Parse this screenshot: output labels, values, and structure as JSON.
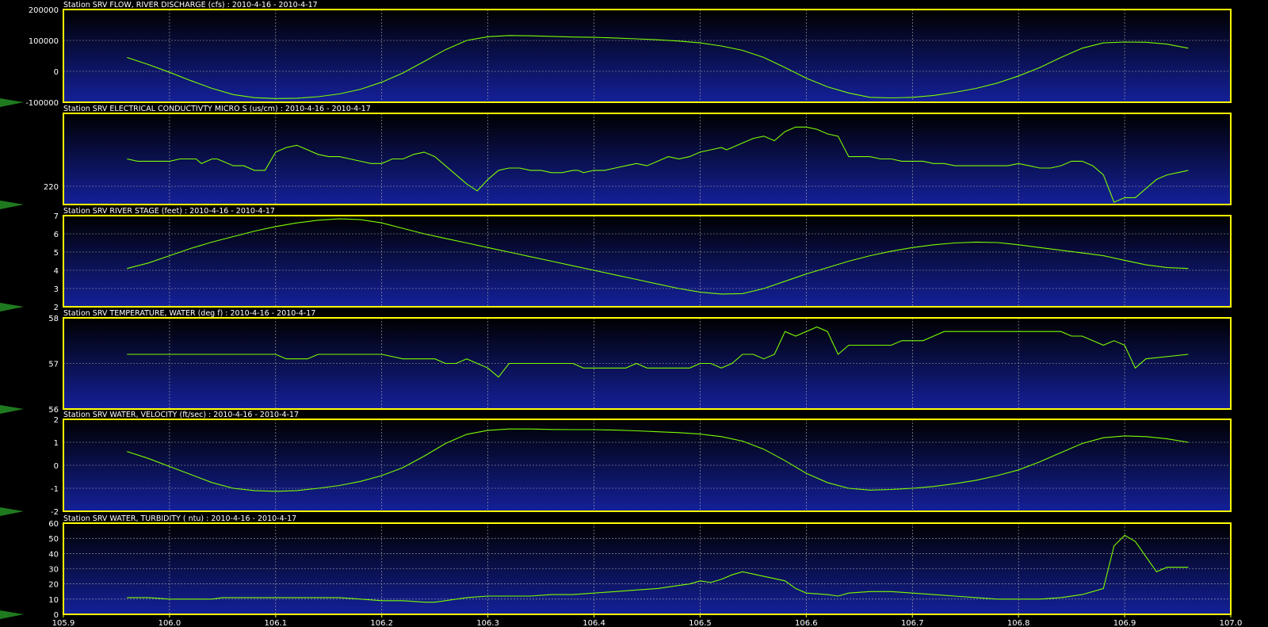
{
  "colors": {
    "background": "#000000",
    "frame": "#ffff00",
    "series": "#7cfc00",
    "panel_top": "#000000",
    "panel_bottom": "#14209a",
    "grid": "#b0b0b0",
    "marker": "#1f7a1f"
  },
  "chart_data": [
    {
      "type": "line",
      "title": "Station SRV FLOW, RIVER DISCHARGE (cfs) : 2010-4-16 - 2010-4-17",
      "ylim": [
        -100000,
        200000
      ],
      "yticks": [
        -100000,
        0,
        100000,
        200000
      ],
      "ytick_labels": [
        "-100000",
        "0",
        "100000",
        "200000"
      ],
      "x": [
        105.96,
        105.98,
        106.0,
        106.02,
        106.04,
        106.06,
        106.08,
        106.1,
        106.12,
        106.14,
        106.16,
        106.18,
        106.2,
        106.22,
        106.24,
        106.26,
        106.28,
        106.3,
        106.32,
        106.34,
        106.36,
        106.38,
        106.4,
        106.42,
        106.44,
        106.46,
        106.48,
        106.5,
        106.52,
        106.54,
        106.56,
        106.58,
        106.6,
        106.62,
        106.64,
        106.66,
        106.68,
        106.7,
        106.72,
        106.74,
        106.76,
        106.78,
        106.8,
        106.82,
        106.84,
        106.86,
        106.88,
        106.9,
        106.92,
        106.94,
        106.96
      ],
      "values": [
        45000,
        22000,
        -3000,
        -30000,
        -55000,
        -75000,
        -85000,
        -88000,
        -87000,
        -82000,
        -73000,
        -58000,
        -35000,
        -5000,
        32000,
        70000,
        100000,
        112000,
        116000,
        115000,
        113000,
        111000,
        110000,
        108000,
        105000,
        102000,
        98000,
        92000,
        82000,
        68000,
        45000,
        12000,
        -22000,
        -50000,
        -70000,
        -84000,
        -86000,
        -84000,
        -78000,
        -68000,
        -55000,
        -38000,
        -15000,
        12000,
        45000,
        75000,
        92000,
        95000,
        94000,
        88000,
        75000
      ]
    },
    {
      "type": "line",
      "title": "Station SRV ELECTRICAL CONDUCTIVTY MICRO S (us/cm) : 2010-4-16 - 2010-4-17",
      "ylim": [
        212,
        252
      ],
      "yticks": [
        220
      ],
      "ytick_labels": [
        "220"
      ],
      "x": [
        105.96,
        105.97,
        105.98,
        105.99,
        106.0,
        106.01,
        106.02,
        106.025,
        106.03,
        106.04,
        106.045,
        106.05,
        106.06,
        106.07,
        106.08,
        106.09,
        106.1,
        106.11,
        106.12,
        106.13,
        106.14,
        106.15,
        106.16,
        106.17,
        106.18,
        106.19,
        106.2,
        106.21,
        106.22,
        106.23,
        106.24,
        106.25,
        106.26,
        106.27,
        106.28,
        106.29,
        106.3,
        106.31,
        106.32,
        106.33,
        106.34,
        106.35,
        106.36,
        106.37,
        106.38,
        106.385,
        106.39,
        106.4,
        106.41,
        106.42,
        106.43,
        106.44,
        106.45,
        106.46,
        106.47,
        106.48,
        106.49,
        106.5,
        106.51,
        106.52,
        106.525,
        106.53,
        106.54,
        106.55,
        106.56,
        106.57,
        106.58,
        106.59,
        106.6,
        106.61,
        106.62,
        106.63,
        106.64,
        106.65,
        106.66,
        106.67,
        106.68,
        106.69,
        106.7,
        106.71,
        106.72,
        106.73,
        106.74,
        106.75,
        106.76,
        106.77,
        106.78,
        106.79,
        106.8,
        106.81,
        106.82,
        106.83,
        106.84,
        106.85,
        106.86,
        106.87,
        106.88,
        106.89,
        106.9,
        106.91,
        106.92,
        106.93,
        106.94,
        106.95,
        106.96
      ],
      "values": [
        232,
        231,
        231,
        231,
        231,
        232,
        232,
        232,
        230,
        232,
        232,
        231,
        229,
        229,
        227,
        227,
        235,
        237,
        238,
        236,
        234,
        233,
        233,
        232,
        231,
        230,
        230,
        232,
        232,
        234,
        235,
        233,
        229,
        225,
        221,
        218,
        223,
        227,
        228,
        228,
        227,
        227,
        226,
        226,
        227,
        227,
        226,
        227,
        227,
        228,
        229,
        230,
        229,
        231,
        233,
        232,
        233,
        235,
        236,
        237,
        236,
        237,
        239,
        241,
        242,
        240,
        244,
        246,
        246,
        245,
        243,
        242,
        233,
        233,
        233,
        232,
        232,
        231,
        231,
        231,
        230,
        230,
        229,
        229,
        229,
        229,
        229,
        229,
        230,
        229,
        228,
        228,
        229,
        231,
        231,
        229,
        225,
        213,
        215,
        215,
        219,
        223,
        225,
        226,
        227
      ]
    },
    {
      "type": "line",
      "title": "Station SRV RIVER STAGE (feet) : 2010-4-16 - 2010-4-17",
      "ylim": [
        2,
        7
      ],
      "yticks": [
        2,
        3,
        4,
        5,
        6,
        7
      ],
      "ytick_labels": [
        "2",
        "3",
        "4",
        "5",
        "6",
        "7"
      ],
      "x": [
        105.96,
        105.98,
        106.0,
        106.02,
        106.04,
        106.06,
        106.08,
        106.1,
        106.12,
        106.14,
        106.16,
        106.18,
        106.2,
        106.22,
        106.24,
        106.26,
        106.28,
        106.3,
        106.32,
        106.34,
        106.36,
        106.38,
        106.4,
        106.42,
        106.44,
        106.46,
        106.48,
        106.5,
        106.52,
        106.54,
        106.56,
        106.58,
        106.6,
        106.62,
        106.64,
        106.66,
        106.68,
        106.7,
        106.72,
        106.74,
        106.76,
        106.78,
        106.8,
        106.82,
        106.84,
        106.86,
        106.88,
        106.9,
        106.92,
        106.94,
        106.96
      ],
      "values": [
        4.1,
        4.4,
        4.8,
        5.2,
        5.55,
        5.85,
        6.15,
        6.4,
        6.6,
        6.75,
        6.82,
        6.78,
        6.6,
        6.3,
        6.0,
        5.75,
        5.5,
        5.25,
        5.0,
        4.75,
        4.5,
        4.25,
        4.0,
        3.75,
        3.5,
        3.25,
        3.0,
        2.8,
        2.7,
        2.72,
        3.0,
        3.4,
        3.8,
        4.15,
        4.5,
        4.8,
        5.05,
        5.25,
        5.4,
        5.5,
        5.55,
        5.52,
        5.4,
        5.25,
        5.1,
        4.95,
        4.8,
        4.55,
        4.3,
        4.15,
        4.1
      ]
    },
    {
      "type": "line",
      "title": "Station SRV TEMPERATURE, WATER (deg f) : 2010-4-16 - 2010-4-17",
      "ylim": [
        56,
        58
      ],
      "yticks": [
        56,
        57,
        58
      ],
      "ytick_labels": [
        "56",
        "57",
        "58"
      ],
      "x": [
        105.96,
        106.1,
        106.11,
        106.13,
        106.14,
        106.2,
        106.22,
        106.24,
        106.25,
        106.26,
        106.27,
        106.28,
        106.29,
        106.3,
        106.31,
        106.32,
        106.33,
        106.34,
        106.38,
        106.39,
        106.42,
        106.43,
        106.44,
        106.45,
        106.49,
        106.5,
        106.51,
        106.52,
        106.53,
        106.54,
        106.55,
        106.56,
        106.57,
        106.58,
        106.59,
        106.6,
        106.61,
        106.62,
        106.63,
        106.64,
        106.65,
        106.66,
        106.67,
        106.68,
        106.69,
        106.7,
        106.71,
        106.72,
        106.73,
        106.74,
        106.84,
        106.85,
        106.86,
        106.87,
        106.88,
        106.89,
        106.9,
        106.91,
        106.92,
        106.96
      ],
      "values": [
        57.2,
        57.2,
        57.1,
        57.1,
        57.2,
        57.2,
        57.1,
        57.1,
        57.1,
        57.0,
        57.0,
        57.1,
        57.0,
        56.9,
        56.7,
        57.0,
        57.0,
        57.0,
        57.0,
        56.9,
        56.9,
        56.9,
        57.0,
        56.9,
        56.9,
        57.0,
        57.0,
        56.9,
        57.0,
        57.2,
        57.2,
        57.1,
        57.2,
        57.7,
        57.6,
        57.7,
        57.8,
        57.7,
        57.2,
        57.4,
        57.4,
        57.4,
        57.4,
        57.4,
        57.5,
        57.5,
        57.5,
        57.6,
        57.7,
        57.7,
        57.7,
        57.6,
        57.6,
        57.5,
        57.4,
        57.5,
        57.4,
        56.9,
        57.1,
        57.2
      ]
    },
    {
      "type": "line",
      "title": "Station SRV WATER, VELOCITY (ft/sec) : 2010-4-16 - 2010-4-17",
      "ylim": [
        -2,
        2
      ],
      "yticks": [
        -2,
        -1,
        0,
        1,
        2
      ],
      "ytick_labels": [
        "-2",
        "-1",
        "0",
        "1",
        "2"
      ],
      "x": [
        105.96,
        105.98,
        106.0,
        106.02,
        106.04,
        106.06,
        106.08,
        106.1,
        106.12,
        106.14,
        106.16,
        106.18,
        106.2,
        106.22,
        106.24,
        106.26,
        106.28,
        106.3,
        106.32,
        106.34,
        106.36,
        106.38,
        106.4,
        106.42,
        106.44,
        106.46,
        106.48,
        106.5,
        106.52,
        106.54,
        106.56,
        106.58,
        106.6,
        106.62,
        106.64,
        106.66,
        106.68,
        106.7,
        106.72,
        106.74,
        106.76,
        106.78,
        106.8,
        106.82,
        106.84,
        106.86,
        106.88,
        106.9,
        106.92,
        106.94,
        106.96
      ],
      "values": [
        0.6,
        0.3,
        -0.05,
        -0.4,
        -0.75,
        -1.0,
        -1.1,
        -1.13,
        -1.1,
        -1.0,
        -0.88,
        -0.7,
        -0.45,
        -0.1,
        0.4,
        0.95,
        1.35,
        1.52,
        1.58,
        1.58,
        1.56,
        1.55,
        1.55,
        1.53,
        1.5,
        1.46,
        1.42,
        1.36,
        1.25,
        1.05,
        0.7,
        0.2,
        -0.35,
        -0.75,
        -1.0,
        -1.08,
        -1.05,
        -1.0,
        -0.92,
        -0.8,
        -0.65,
        -0.45,
        -0.2,
        0.15,
        0.55,
        0.95,
        1.2,
        1.28,
        1.25,
        1.15,
        1.0
      ]
    },
    {
      "type": "line",
      "title": "Station SRV WATER, TURBIDITY (  ntu) : 2010-4-16 - 2010-4-17",
      "ylim": [
        0,
        60
      ],
      "yticks": [
        0,
        10,
        20,
        30,
        40,
        50,
        60
      ],
      "ytick_labels": [
        "0",
        "10",
        "20",
        "30",
        "40",
        "50",
        "60"
      ],
      "xticks": [
        105.9,
        106.0,
        106.1,
        106.2,
        106.3,
        106.4,
        106.5,
        106.6,
        106.7,
        106.8,
        106.9,
        107.0
      ],
      "xtick_labels": [
        "105.9",
        "106.0",
        "106.1",
        "106.2",
        "106.3",
        "106.4",
        "106.5",
        "106.6",
        "106.7",
        "106.8",
        "106.9",
        "107.0"
      ],
      "x": [
        105.96,
        105.98,
        106.0,
        106.02,
        106.04,
        106.05,
        106.06,
        106.1,
        106.12,
        106.14,
        106.16,
        106.18,
        106.2,
        106.22,
        106.24,
        106.25,
        106.26,
        106.28,
        106.3,
        106.32,
        106.34,
        106.36,
        106.38,
        106.4,
        106.42,
        106.44,
        106.46,
        106.48,
        106.49,
        106.5,
        106.51,
        106.52,
        106.53,
        106.54,
        106.56,
        106.58,
        106.59,
        106.6,
        106.62,
        106.63,
        106.64,
        106.66,
        106.68,
        106.7,
        106.72,
        106.74,
        106.76,
        106.78,
        106.8,
        106.82,
        106.84,
        106.86,
        106.87,
        106.88,
        106.89,
        106.9,
        106.91,
        106.92,
        106.93,
        106.94,
        106.96
      ],
      "values": [
        11,
        11,
        10,
        10,
        10,
        11,
        11,
        11,
        11,
        11,
        11,
        10,
        9,
        9,
        8,
        8,
        9,
        11,
        12,
        12,
        12,
        13,
        13,
        14,
        15,
        16,
        17,
        19,
        20,
        22,
        21,
        23,
        26,
        28,
        25,
        22,
        17,
        14,
        13,
        12,
        14,
        15,
        15,
        14,
        13,
        12,
        11,
        10,
        10,
        10,
        11,
        13,
        15,
        17,
        45,
        52,
        48,
        38,
        28,
        31,
        31
      ]
    }
  ]
}
